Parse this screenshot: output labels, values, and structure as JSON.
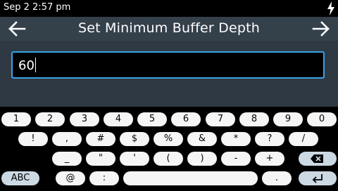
{
  "status": {
    "time": "Sep 2 2:57 pm",
    "icon": "charging-bolt-icon"
  },
  "header": {
    "title": "Set Minimum Buffer Depth",
    "back_icon": "arrow-left-icon",
    "next_icon": "arrow-right-icon"
  },
  "input": {
    "value": "60"
  },
  "keyboard": {
    "row1": [
      "1",
      "2",
      "3",
      "4",
      "5",
      "6",
      "7",
      "8",
      "9",
      "0"
    ],
    "row2": [
      "!",
      ",",
      "#",
      "$",
      "%",
      "&",
      "*",
      "?",
      "/"
    ],
    "row3": [
      "_",
      "\"",
      "'",
      "(",
      ")",
      "-",
      "+"
    ],
    "row4": {
      "abc_label": "ABC",
      "at": "@",
      "colon": ":",
      "space": "",
      "period": "."
    },
    "backspace_icon": "backspace-icon",
    "enter_icon": "enter-icon",
    "colors": {
      "key": "#f5f5f5",
      "special_key": "#ccd9e3"
    }
  }
}
